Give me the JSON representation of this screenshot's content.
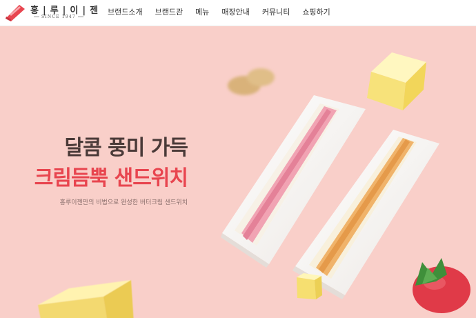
{
  "brand": {
    "name": "홍|루|이|젠",
    "since": "SINCE 1947",
    "color": "#e8454f"
  },
  "nav": {
    "items": [
      "브랜드소개",
      "브랜드관",
      "메뉴",
      "매장안내",
      "커뮤니티",
      "쇼핑하기"
    ]
  },
  "hero": {
    "headline_1": "달콤 풍미 가득",
    "headline_2": "크림듬뿍 샌드위치",
    "subtext": "홍루이젠만의 비법으로 완성한 버터크림 샌드위치",
    "background": "#f9cfc9",
    "accent": "#e8454f"
  }
}
